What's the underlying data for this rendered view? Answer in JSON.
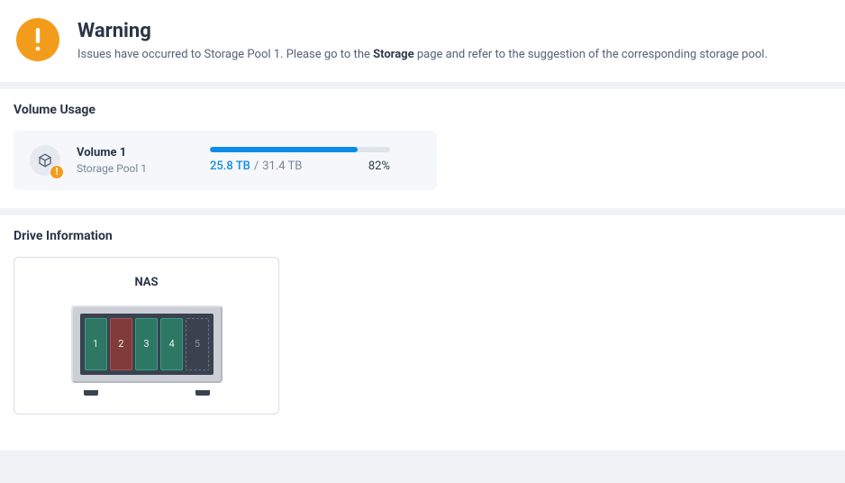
{
  "warning": {
    "title": "Warning",
    "msg_pre": "Issues have occurred to Storage Pool 1. Please go to the ",
    "msg_bold": "Storage",
    "msg_post": " page and refer to the suggestion of the corresponding storage pool."
  },
  "volume_usage": {
    "section_title": "Volume Usage",
    "volume": {
      "name": "Volume 1",
      "pool": "Storage Pool 1",
      "badge": "!",
      "used": "25.8 TB",
      "total": "31.4 TB",
      "percent": "82%",
      "percent_value": 82
    }
  },
  "drive_info": {
    "section_title": "Drive Information",
    "device_label": "NAS",
    "drives": [
      {
        "num": "1",
        "status": "ok"
      },
      {
        "num": "2",
        "status": "err"
      },
      {
        "num": "3",
        "status": "ok"
      },
      {
        "num": "4",
        "status": "ok"
      },
      {
        "num": "5",
        "status": "empty"
      }
    ]
  }
}
